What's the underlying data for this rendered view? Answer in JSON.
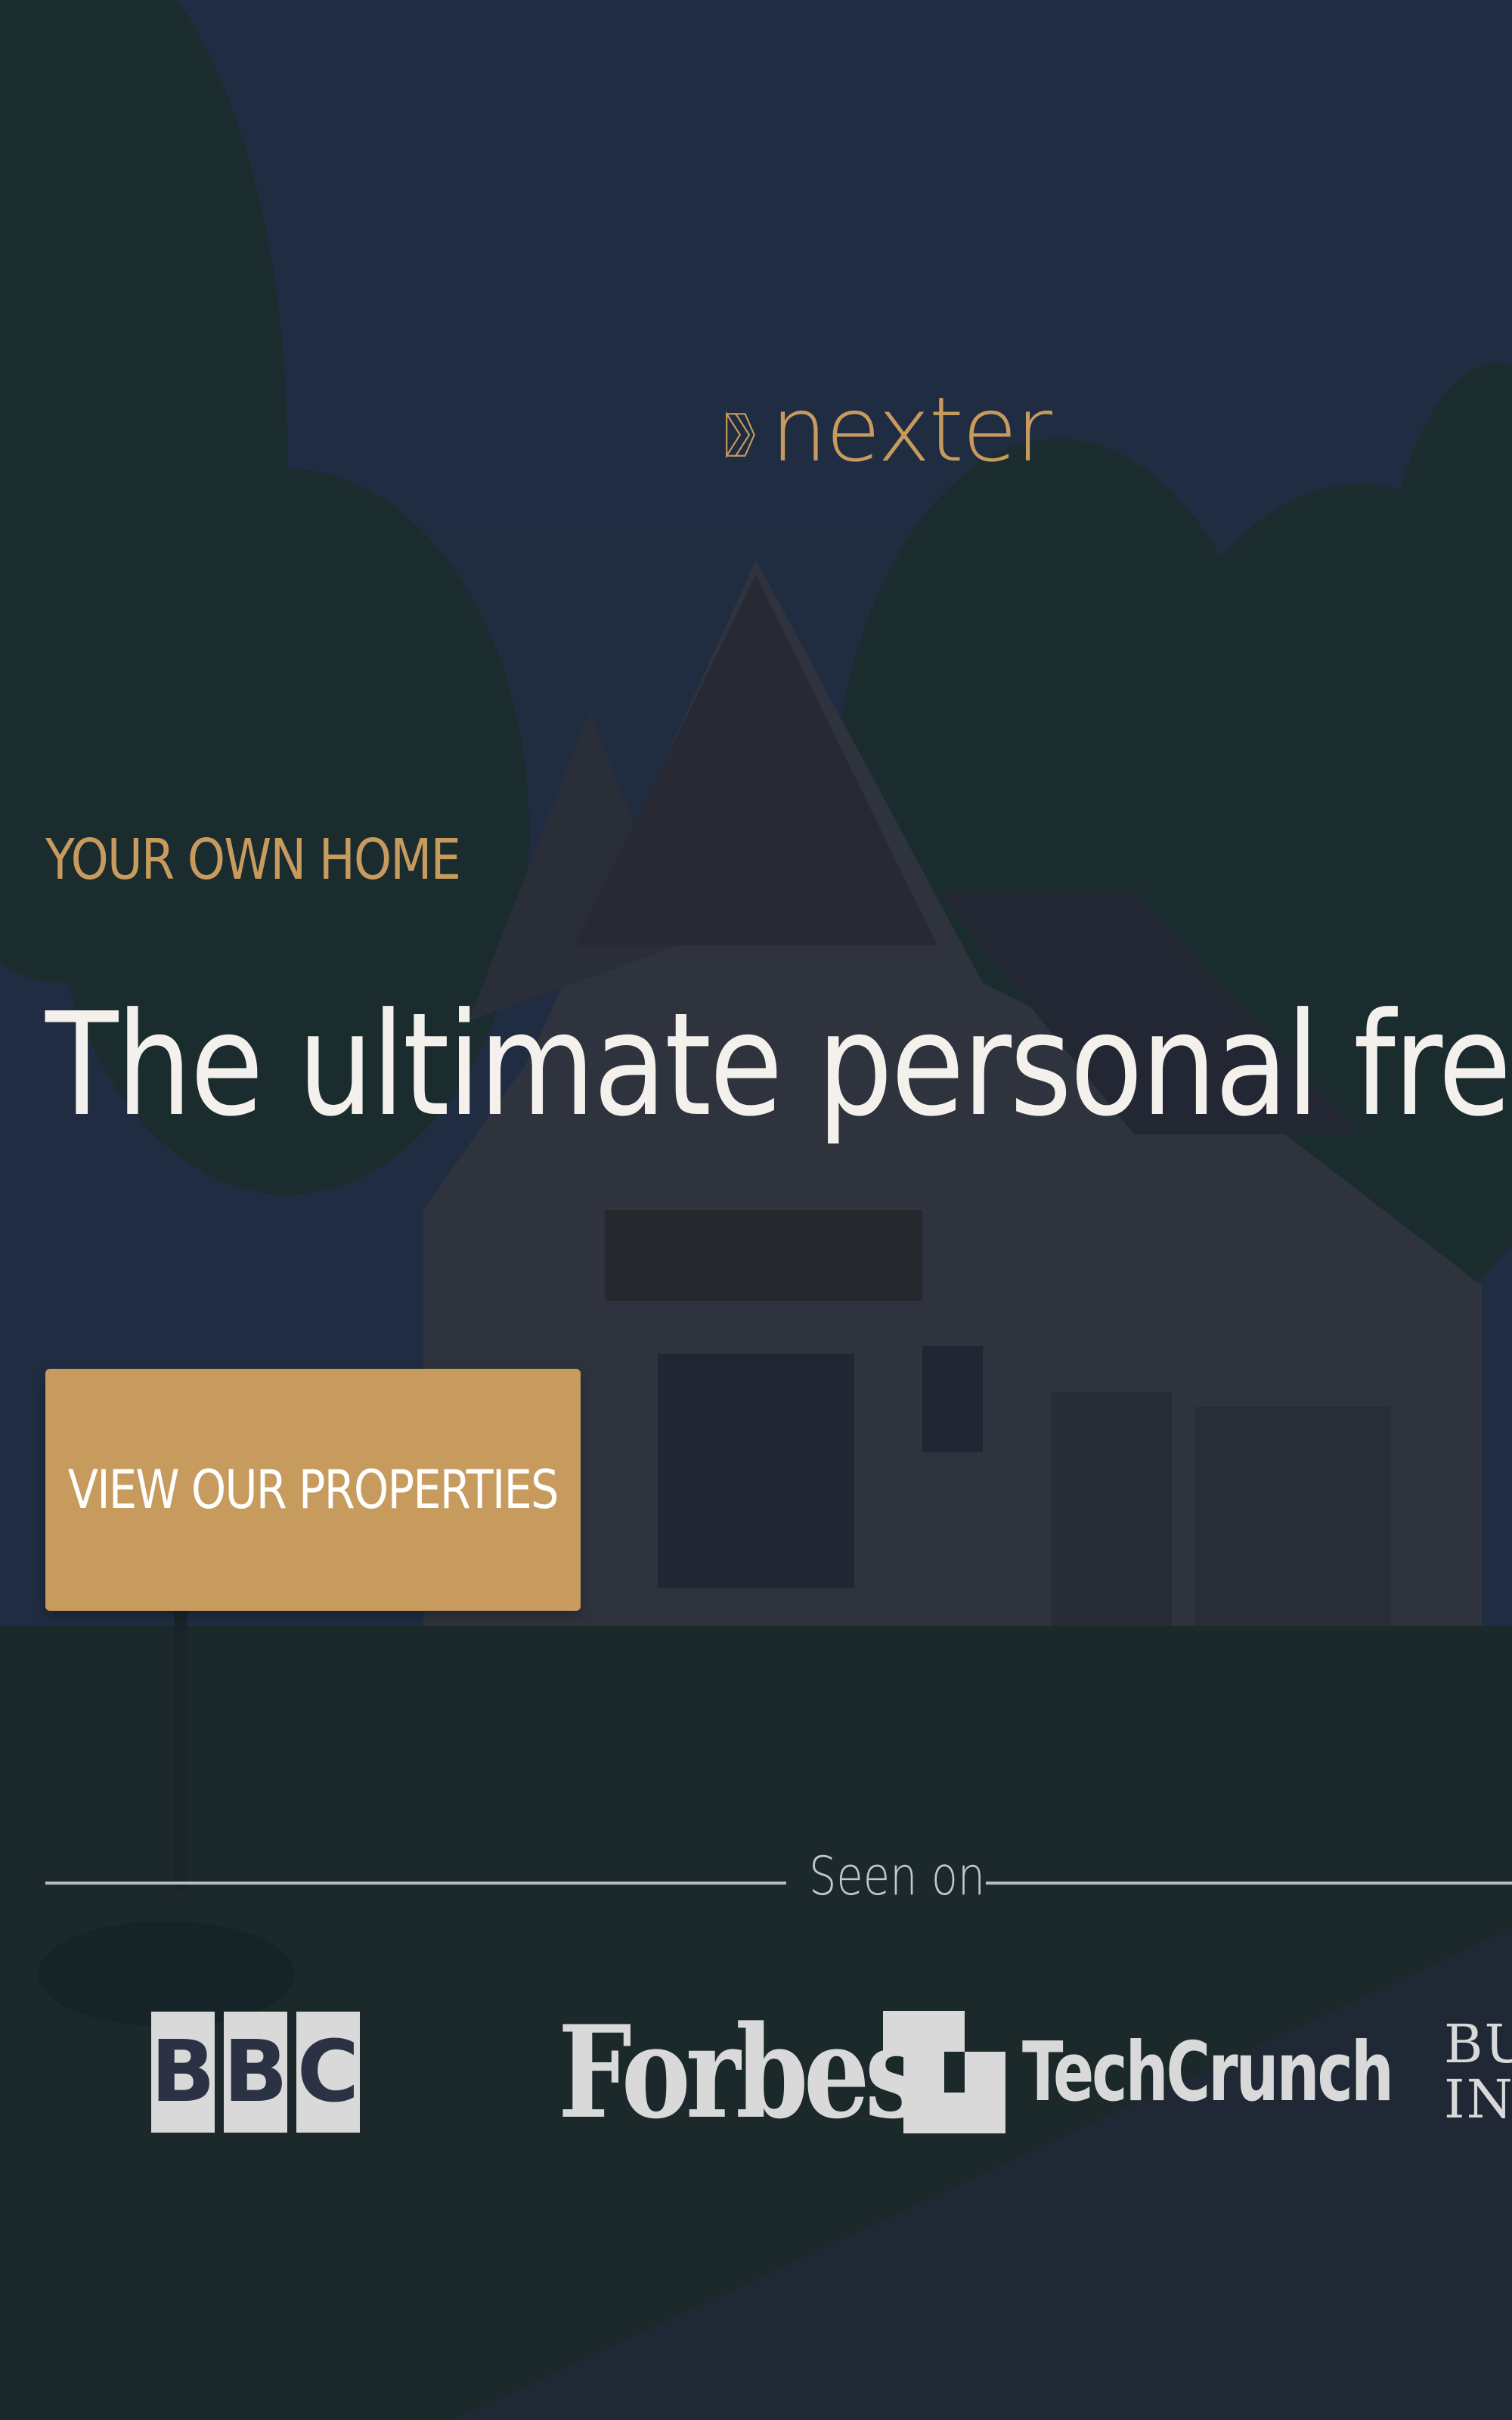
{
  "colors": {
    "accent": "#c79a5d",
    "heading": "#f4f1ec",
    "overlay": "#1c2536",
    "muted": "#b9bcc2",
    "press_logo": "#d9d9d9"
  },
  "brand": {
    "logo_icon": "triple-chevron-icon",
    "name": "nexter"
  },
  "hero": {
    "subtitle": "YOUR OWN HOME",
    "headline": "The ultimate personal freedom",
    "cta_label": "VIEW OUR PROPERTIES"
  },
  "seen_on": {
    "label": "Seen on",
    "logos": {
      "bbc": [
        "B",
        "B",
        "C"
      ],
      "forbes": "Forbes",
      "techcrunch": "TechCrunch",
      "business_insider": [
        "BUSI",
        "INSI"
      ]
    }
  }
}
